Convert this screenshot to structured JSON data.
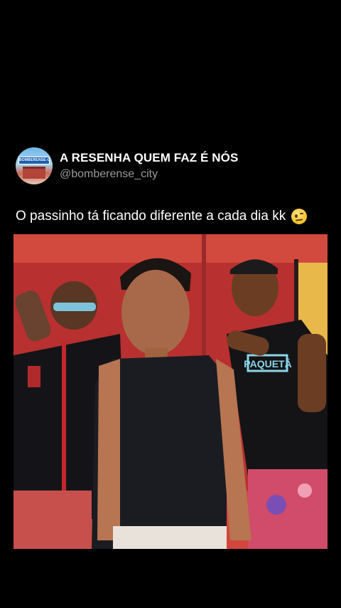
{
  "post": {
    "avatar_text": "BOMBERENSE-CITY",
    "display_name": "A RESENHA QUEM FAZ É NÓS",
    "handle": "@bomberense_city",
    "caption": "O passinho tá ficando diferente a cada dia kk",
    "caption_emoji": "face-with-raised-eyebrow-icon"
  },
  "video": {
    "shirt_text": "PAQUETÁ"
  },
  "colors": {
    "background": "#000000",
    "text_primary": "#ffffff",
    "text_secondary": "#9a9a9a"
  }
}
